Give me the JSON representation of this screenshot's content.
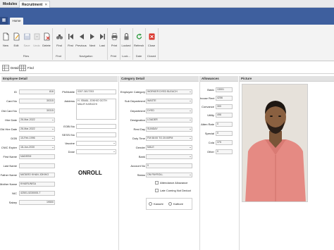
{
  "window_tabs": [
    {
      "label": "Modules"
    },
    {
      "label": "Recruitment",
      "close": "✕"
    }
  ],
  "ribbon": {
    "app_button": "▦",
    "home_tab": "Home",
    "buttons": {
      "new": "New",
      "edit": "Edit",
      "save": "Save",
      "undo": "Undo",
      "delete": "Delete",
      "find": "Find",
      "first": "First",
      "previous": "Previous",
      "next": "Next",
      "last": "Last",
      "print": "Print",
      "locked": "Locked",
      "refresh": "Refresh",
      "close": "Close"
    },
    "groups": {
      "files": "Files",
      "find": "Find",
      "navigation": "Navigation",
      "print": "Print",
      "lock": "Lock...",
      "date": "Date",
      "closed": "Closed"
    }
  },
  "view_tabs": [
    {
      "label": "Detail"
    },
    {
      "label": "Find"
    }
  ],
  "sections": {
    "employee_detail": "Employee Detail",
    "category_detail": "Category Detail",
    "allowances": "Allowances",
    "picture": "Picture"
  },
  "employee": {
    "id_label": "ID",
    "id": "816",
    "card_no_label": "Card No",
    "card_no": "30315",
    "old_card_label": "Old Card No",
    "old_card": "30315",
    "hire_date_label": "Hire Date",
    "hire_date": "26-Mar-2022",
    "old_hire_label": "Old Hire Date",
    "old_hire": "26-Mar-2022",
    "dob_label": "DOB",
    "dob": "10-Feb-1996",
    "cnic_expire_label": "CNIC Expire",
    "cnic_expire": "18-Jun-2030",
    "first_name_label": "First Name",
    "first_name": "NADEEM",
    "last_name_label": "Last Name",
    "last_name": "",
    "father_name_label": "Father Name",
    "father_name": "MATARO KHAN JOKHIO",
    "mother_name_label": "Mother Name",
    "mother_name": "KHAIRUNISA",
    "nic_label": "NIC",
    "nic": "42501-5230005-7",
    "salary_label": "Salary",
    "salary": "19500",
    "ph_mobile_label": "Ph/Mobile",
    "ph_mobile": "0307-3817253",
    "address_label": "Address",
    "address": "H. ISMAIL JOKHIO GOTH MALIR KARACHI",
    "eobi_label": "EOBI No",
    "eobi": "",
    "sessi_label": "SESSI No",
    "sessi": "",
    "vaccine_label": "Vaccine",
    "vaccine": "",
    "dose_label": "Dose",
    "dose": "",
    "status_text": "ONROLL"
  },
  "category": {
    "emp_category_label": "Employee Category",
    "emp_category": "WORKER DYED BLEACH",
    "sub_department_label": "Sub Department",
    "sub_department": "WASTE",
    "department_label": "Department",
    "department": "DYED",
    "designation_label": "Designation",
    "designation": "LOADER",
    "rest_day_label": "Rest Day",
    "rest_day": "SUNDAY",
    "duty_time_label": "Duty Time",
    "duty_time": "FM 08:00 TO 20:00PM",
    "gender_label": "Gender",
    "gender": "MALE",
    "bank_label": "Bank",
    "bank": "",
    "account_no_label": "Account No",
    "account_no": "0",
    "status_label": "Status",
    "status": "ON PAYROLL",
    "attendance_allowance_label": "Attendance Allowance",
    "late_coming_label": "Late Coming Not Deduct",
    "location_karachi": "Karachi",
    "location_kathore": "Kathore"
  },
  "allowances": {
    "basic_label": "Basic",
    "basic": "13001",
    "house_rent_label": "house Rent",
    "house_rent": "4256",
    "conveyance_label": "Convance",
    "conveyance": "300",
    "utility_label": "Utility",
    "utility": "496",
    "atten_rate_label": "Atten Rate",
    "atten_rate": "0",
    "special_label": "Special",
    "special": "0",
    "cola_label": "Cola",
    "cola": "375",
    "other_label": "Other",
    "other": "0"
  },
  "colors": {
    "ribbon_blue": "#3e5f9e",
    "header_gray": "#e2e2e2",
    "close_red": "#d9342b",
    "refresh_green": "#2a9a3c"
  }
}
